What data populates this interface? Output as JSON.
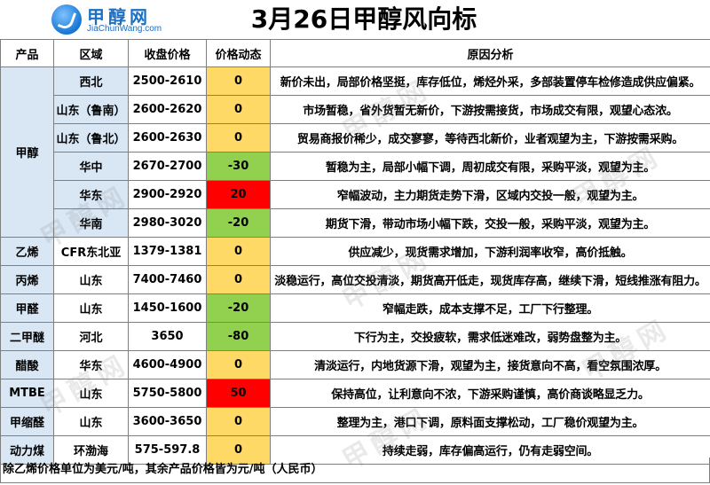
{
  "header": {
    "title": "3月26日甲醇风向标",
    "logo_cn": "甲醇网",
    "logo_en": "JiaChunWang.com"
  },
  "columns": [
    "产品",
    "区域",
    "收盘价格",
    "价格动态",
    "原因分析"
  ],
  "rows": [
    {
      "product": "甲醇",
      "region": "西北",
      "price": "2500-2610",
      "change": "0",
      "trend": "zero",
      "reason": "新价未出，局部价格坚挺，库存低位，烯烃外采，多部装置停车检修造成供应偏紧。"
    },
    {
      "product": "",
      "region": "山东（鲁南）",
      "price": "2600-2620",
      "change": "0",
      "trend": "zero",
      "reason": "市场暂稳，省外货暂无新价，下游按需接货，市场成交有限，观望心态浓。"
    },
    {
      "product": "",
      "region": "山东（鲁北）",
      "price": "2600-2630",
      "change": "0",
      "trend": "zero",
      "reason": "贸易商报价稀少，成交寥寥，等待西北新价，业者观望为主，下游按需采购。"
    },
    {
      "product": "",
      "region": "华中",
      "price": "2670-2700",
      "change": "-30",
      "trend": "down",
      "reason": "暂稳为主，局部小幅下调，周初成交有限，采购平淡，观望为主。"
    },
    {
      "product": "",
      "region": "华东",
      "price": "2900-2920",
      "change": "20",
      "trend": "up",
      "reason": "窄幅波动，主力期货走势下滑，区域内交投一般，观望为主。"
    },
    {
      "product": "",
      "region": "华南",
      "price": "2980-3020",
      "change": "-20",
      "trend": "down",
      "reason": "期货下滑，带动市场小幅下跌，交投一般，采购平淡，观望为主。"
    },
    {
      "product": "乙烯",
      "region": "CFR东北亚",
      "price": "1379-1381",
      "change": "0",
      "trend": "zero",
      "reason": "供应减少，现货需求增加，下游利润率收窄，高价抵触。"
    },
    {
      "product": "丙烯",
      "region": "山东",
      "price": "7400-7460",
      "change": "0",
      "trend": "zero",
      "reason": "淡稳运行，高位交投清淡，期货高开低走，现货库存高，继续下滑，短线推涨有阻力。"
    },
    {
      "product": "甲醛",
      "region": "山东",
      "price": "1450-1600",
      "change": "-20",
      "trend": "down",
      "reason": "窄幅走跌，成本支撑不足，工厂下行整理。"
    },
    {
      "product": "二甲醚",
      "region": "河北",
      "price": "3650",
      "change": "-80",
      "trend": "down",
      "reason": "下行为主，交投疲软，需求低迷难改，弱势盘整为主。"
    },
    {
      "product": "醋酸",
      "region": "华东",
      "price": "4600-4900",
      "change": "0",
      "trend": "zero",
      "reason": "清淡运行，内地货源下滑，观望为主，接货意向不高，看空氛围浓厚。"
    },
    {
      "product": "MTBE",
      "region": "山东",
      "price": "5750-5800",
      "change": "50",
      "trend": "up",
      "reason": "保持高位，让利意向不浓，下游采购谨慎，高价商谈略显乏力。"
    },
    {
      "product": "甲缩醛",
      "region": "山东",
      "price": "3600-3650",
      "change": "0",
      "trend": "zero",
      "reason": "整理为主，港口下调，原料面支撑松动，工厂稳价观望为主。"
    },
    {
      "product": "动力煤",
      "region": "环渤海",
      "price": "575-597.8",
      "change": "0",
      "trend": "zero",
      "reason": "持续走弱，库存偏高运行，仍有走弱空间。"
    }
  ],
  "footer": {
    "note": "除乙烯价格单位为美元/吨，其余产品价格皆为元/吨（人民币）"
  },
  "watermark": "甲醇网",
  "colors": {
    "header_blue": "#1b6fc4",
    "product_cell": "#d9e7f5",
    "change_zero": "#ffd966",
    "change_down": "#92d050",
    "change_up": "#ff0000"
  }
}
